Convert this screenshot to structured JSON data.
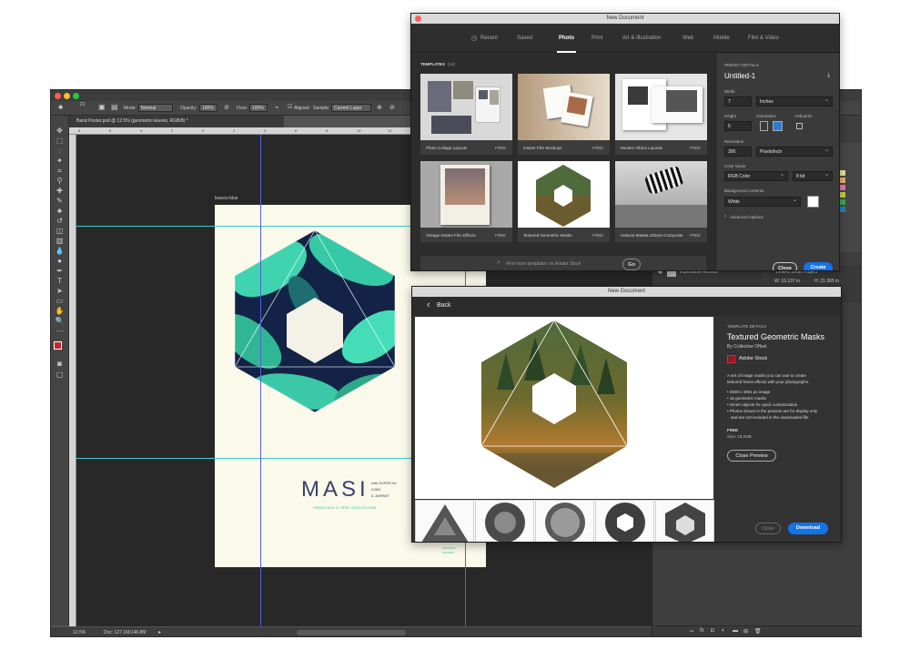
{
  "photoshop": {
    "options_bar": {
      "mode_label": "Mode:",
      "mode_value": "Normal",
      "opacity_label": "Opacity:",
      "opacity_value": "100%",
      "flow_label": "Flow:",
      "flow_value": "100%",
      "aligned_label": "Aligned",
      "sample_label": "Sample:",
      "sample_value": "Current Layer",
      "brush_size": "21"
    },
    "document_tab": "Band Poster.psd @ 12.5% (geometric-leaves, RGB/8) *",
    "ruler_numbers": [
      "8",
      "6",
      "4",
      "2",
      "0",
      "2",
      "4",
      "6",
      "8",
      "10",
      "12"
    ],
    "artboard_label": "leaves-blue",
    "poster": {
      "title": "MASI",
      "with_line1": "with SUPER 64",
      "with_line2": "DJMJ",
      "with_line3": "& JARRØT",
      "date_line": "FRIDAY NOV 3 / 9PM / 2013 FOLSOM",
      "small_bottom1": "ADVANCE",
      "small_bottom2": "FOLSOM"
    },
    "status": {
      "zoom": "12.5%",
      "doc": "Doc: 127.1M/148.8M"
    },
    "panels": {
      "layer_name": "impossible records",
      "linked_smart_object": "Linked Smart Object",
      "w_value": "W: 16.137 in",
      "h_value": "H: 21.365 in"
    }
  },
  "new_document_dialog": {
    "window_title": "New Document",
    "tabs": [
      {
        "label": "Recent"
      },
      {
        "label": "Saved"
      },
      {
        "label": "Photo"
      },
      {
        "label": "Print"
      },
      {
        "label": "Art & Illustration"
      },
      {
        "label": "Web"
      },
      {
        "label": "Mobile"
      },
      {
        "label": "Film & Video"
      }
    ],
    "active_tab": "Photo",
    "templates_heading": "TEMPLATES",
    "templates_count": "(14)",
    "templates": [
      {
        "name": "Photo Collage Layouts",
        "price": "FREE"
      },
      {
        "name": "Instant Film Mockups",
        "price": "FREE"
      },
      {
        "name": "Modern Album Layouts",
        "price": "FREE"
      },
      {
        "name": "Vintage Instant Film Effects",
        "price": "FREE"
      },
      {
        "name": "Textured Geometric Masks",
        "price": "FREE"
      },
      {
        "name": "Hakuna Matata Zebras Composite",
        "price": "FREE"
      }
    ],
    "search_placeholder": "Find more templates on Adobe Stock",
    "go_label": "Go",
    "preset": {
      "heading": "PRESET DETAILS",
      "name": "Untitled-1",
      "width_label": "Width",
      "width_value": "7",
      "width_unit": "Inches",
      "height_label": "Height",
      "height_value": "5",
      "orientation_label": "Orientation",
      "artboards_label": "Artboards",
      "resolution_label": "Resolution",
      "resolution_value": "300",
      "resolution_unit": "Pixels/Inch",
      "color_mode_label": "Color Mode",
      "color_mode_value": "RGB Color",
      "bit_depth": "8 bit",
      "background_label": "Background Contents",
      "background_value": "White",
      "advanced_label": "Advanced Options"
    },
    "close_label": "Close",
    "create_label": "Create"
  },
  "template_detail_dialog": {
    "window_title": "New Document",
    "back_label": "Back",
    "heading": "TEMPLATE DETAILS",
    "title": "Textured Geometric Masks",
    "author": "By Collective Offset",
    "source": "Adobe Stock",
    "description_lines": [
      "A set of image masks you can use to create",
      "textured frame effects with your photographs."
    ],
    "bullets": [
      "3508 x 4961 px image",
      "15 geometric masks",
      "Smart objects for quick customization",
      "Photos shown in the preview are for display only",
      "and are not included in the downloaded file"
    ],
    "price": "FREE",
    "size": "Size: 19.2MB",
    "close_preview_label": "Close Preview",
    "close_label": "Close",
    "download_label": "Download"
  },
  "colors": {
    "accent_blue": "#1473e6",
    "guide_cyan": "#3fc9d3",
    "guide_blue": "#5561d4",
    "poster_bg": "#fbf9ea",
    "poster_title": "#3b3f6a",
    "poster_teal": "#3ec1a6"
  }
}
